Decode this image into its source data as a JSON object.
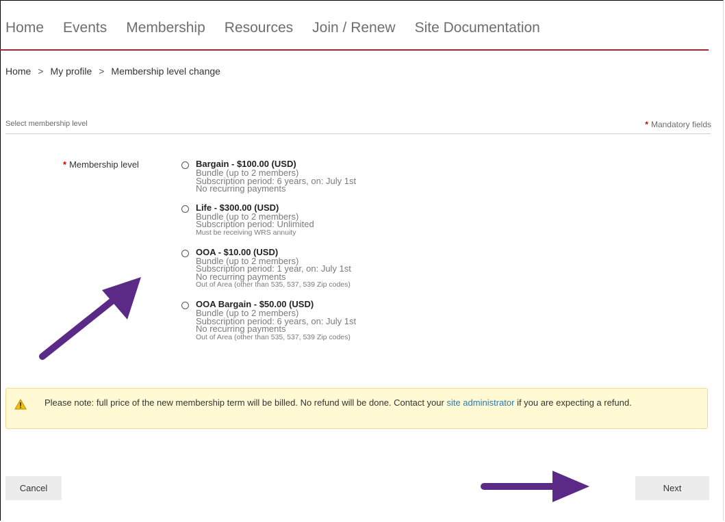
{
  "nav": {
    "items": [
      "Home",
      "Events",
      "Membership",
      "Resources",
      "Join / Renew",
      "Site Documentation"
    ]
  },
  "breadcrumb": {
    "items": [
      "Home",
      "My profile",
      "Membership level change"
    ],
    "separator": ">"
  },
  "section": {
    "title": "Select membership level",
    "mandatory_star": "*",
    "mandatory_text": "Mandatory fields"
  },
  "form": {
    "label_star": "*",
    "label": "Membership level",
    "options": [
      {
        "title": "Bargain - $100.00 (USD)",
        "lines": [
          "Bundle (up to 2 members)",
          "Subscription period: 6 years, on: July 1st",
          "No recurring payments"
        ],
        "note": ""
      },
      {
        "title": "Life - $300.00 (USD)",
        "lines": [
          "Bundle (up to 2 members)",
          "Subscription period: Unlimited"
        ],
        "note": "Must be receiving WRS annuity"
      },
      {
        "title": "OOA - $10.00 (USD)",
        "lines": [
          "Bundle (up to 2 members)",
          "Subscription period: 1 year, on: July 1st",
          "No recurring payments"
        ],
        "note": "Out of Area (other than 535, 537, 539 Zip codes)"
      },
      {
        "title": "OOA Bargain - $50.00 (USD)",
        "lines": [
          "Bundle (up to 2 members)",
          "Subscription period: 6 years, on: July 1st",
          "No recurring payments"
        ],
        "note": "Out of Area (other than 535, 537, 539 Zip codes)"
      }
    ]
  },
  "notice": {
    "text_before": "Please note: full price of the new membership term will be billed. No refund will be done. Contact your ",
    "link": "site administrator",
    "text_after": " if you are expecting a refund."
  },
  "buttons": {
    "cancel": "Cancel",
    "next": "Next"
  },
  "colors": {
    "nav_rule": "#a3272c",
    "star": "#d40000",
    "link": "#2a7ab8",
    "notice_bg": "#fff9d4",
    "annotation_arrow": "#5b2a86"
  }
}
